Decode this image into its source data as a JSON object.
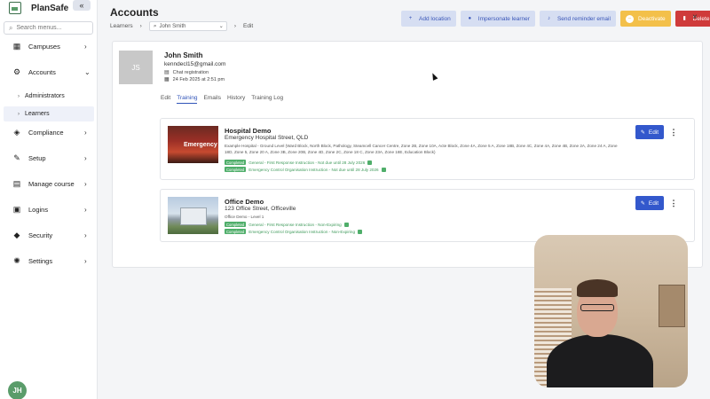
{
  "sidebar": {
    "brand": "PlanSafe",
    "collapse_icon": "«",
    "search_placeholder": "Search menus...",
    "items": [
      {
        "label": "Campuses",
        "icon": "building-icon",
        "glyph": "▦",
        "chevron": "›"
      },
      {
        "label": "Accounts",
        "icon": "users-cog-icon",
        "glyph": "⚙",
        "chevron": "⌄"
      },
      {
        "label": "Compliance",
        "icon": "shield-check-icon",
        "glyph": "◈",
        "chevron": "›"
      },
      {
        "label": "Setup",
        "icon": "wrench-icon",
        "glyph": "✎",
        "chevron": "›"
      },
      {
        "label": "Manage course",
        "icon": "book-icon",
        "glyph": "▤",
        "chevron": "›"
      },
      {
        "label": "Logins",
        "icon": "lock-icon",
        "glyph": "▣",
        "chevron": "›"
      },
      {
        "label": "Security",
        "icon": "shield-icon",
        "glyph": "◆",
        "chevron": "›"
      },
      {
        "label": "Settings",
        "icon": "gear-icon",
        "glyph": "✺",
        "chevron": "›"
      }
    ],
    "sub_items": [
      {
        "label": "Administrators",
        "active": false
      },
      {
        "label": "Learners",
        "active": true
      }
    ],
    "user_initials": "JH"
  },
  "header": {
    "title": "Accounts",
    "breadcrumb_root": "Learners",
    "breadcrumb_select": "John Smith",
    "breadcrumb_current": "Edit",
    "actions": [
      {
        "label": "Add location",
        "icon": "plus-icon",
        "glyph": "+",
        "style": "soft"
      },
      {
        "label": "Impersonate learner",
        "icon": "user-icon",
        "glyph": "●",
        "style": "soft"
      },
      {
        "label": "Send reminder email",
        "icon": "bell-icon",
        "glyph": "♪",
        "style": "soft"
      },
      {
        "label": "Deactivate",
        "icon": "minus-circle-icon",
        "glyph": "–",
        "style": "warn"
      },
      {
        "label": "Delete",
        "icon": "trash-icon",
        "glyph": "▮",
        "style": "danger"
      }
    ],
    "close": "×"
  },
  "learner": {
    "initials": "JS",
    "name": "John Smith",
    "email": "kenndecl15@gmail.com",
    "registration": "Chat registration",
    "date": "24 Feb 2025 at 2:51 pm"
  },
  "tabs": [
    "Edit",
    "Training",
    "Emails",
    "History",
    "Training Log"
  ],
  "active_tab": "Training",
  "locations": [
    {
      "title": "Hospital Demo",
      "address": "Emergency Hospital Street, QLD",
      "description": "Example Hospital - Ground Level (Ward Block, North Block, Pathology, Steamcell Cancer Centre, Zone 2B, Zone 10A, Acte Block, Zone 4A, Zone 5 A, Zone 18B, Zone 4C, Zone 4A, Zone 4B, Zone 2A, Zone 24 A, Zone 18D, Zone 5, Zone 20 A, Zone 3B, Zone 20B, Zone 4D, Zone 2C, Zone 18 C, Zone 23A, Zone 18E, Education Block)",
      "image_sign": "Emergency",
      "trainings": [
        {
          "status": "Completed",
          "text": "General - First Response Instruction - Not due until 28 July 2026"
        },
        {
          "status": "Completed",
          "text": "Emergency Control Organisation Instruction - Not due until 28 July 2026"
        }
      ],
      "edit_label": "Edit"
    },
    {
      "title": "Office Demo",
      "address": "123 Office Street, Officeville",
      "description": "Office Demo - Level 1",
      "image_sign": "",
      "trainings": [
        {
          "status": "Completed",
          "text": "General - First Response Instruction - Non-Expiring"
        },
        {
          "status": "Completed",
          "text": "Emergency Control Organisation Instruction - Non-Expiring"
        }
      ],
      "edit_label": "Edit"
    }
  ],
  "colors": {
    "primary": "#3358cc",
    "soft_button": "#d6def2",
    "warn": "#f3c04a",
    "danger": "#cf3b3b",
    "success": "#4fae6a"
  }
}
